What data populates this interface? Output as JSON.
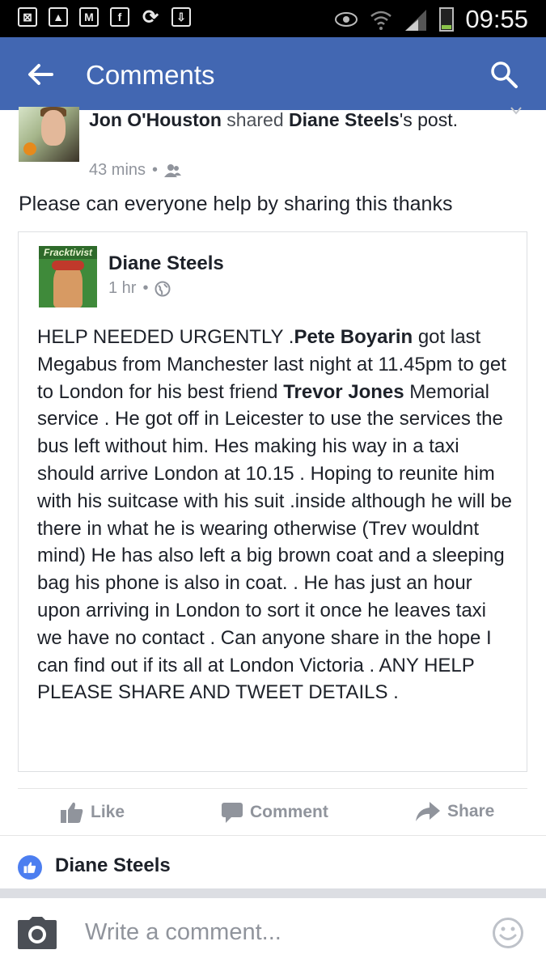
{
  "status_bar": {
    "time": "09:55",
    "left_icons": [
      "screenshot-icon",
      "gallery-icon",
      "gmail-icon",
      "facebook-icon",
      "sync-icon",
      "download-icon"
    ],
    "right_icons": [
      "eye-icon",
      "wifi-icon",
      "signal-icon",
      "battery-icon"
    ]
  },
  "app_bar": {
    "title": "Comments",
    "back_icon": "arrow-left-icon",
    "search_icon": "search-icon",
    "color": "#4267b2"
  },
  "shared_post": {
    "author": "Jon O'Houston",
    "verb": "shared",
    "original_author": "Diane Steels",
    "possessive": "'s",
    "object": "post.",
    "time": "43 mins",
    "separator": "•",
    "privacy_icon": "friends-icon",
    "text": "Please can everyone help by sharing this thanks"
  },
  "original_post": {
    "author": "Diane Steels",
    "avatar_tag": "Fracktivist",
    "time": "1 hr",
    "separator": "•",
    "privacy_icon": "globe-icon",
    "body": [
      {
        "text": "HELP NEEDED URGENTLY .",
        "bold": false
      },
      {
        "text": "Pete Boyarin",
        "bold": true
      },
      {
        "text": " got last Megabus from Manchester last night at 11.45pm to get to London for his best friend ",
        "bold": false
      },
      {
        "text": "Trevor Jones",
        "bold": true
      },
      {
        "text": " Memorial service . He got off in Leicester to use the services the bus left without him. Hes making his way in a taxi should arrive London at 10.15 . Hoping to reunite him with his suitcase with his suit .inside although he will be there in what he is wearing otherwise (Trev wouldnt mind) He has also left a big brown coat and a sleeping bag his phone is also in coat. . He has just an hour upon arriving in London to sort it once he leaves taxi we have no contact . Can anyone share in the hope I can find out if its all at London Victoria . ANY HELP PLEASE SHARE AND TWEET DETAILS .",
        "bold": false
      }
    ]
  },
  "actions": {
    "like": "Like",
    "comment": "Comment",
    "share": "Share"
  },
  "likes": {
    "name": "Diane Steels",
    "badge_color": "#4c7ef0"
  },
  "composer": {
    "placeholder": "Write a comment...",
    "camera_icon": "camera-icon",
    "emoji_icon": "smiley-icon"
  }
}
